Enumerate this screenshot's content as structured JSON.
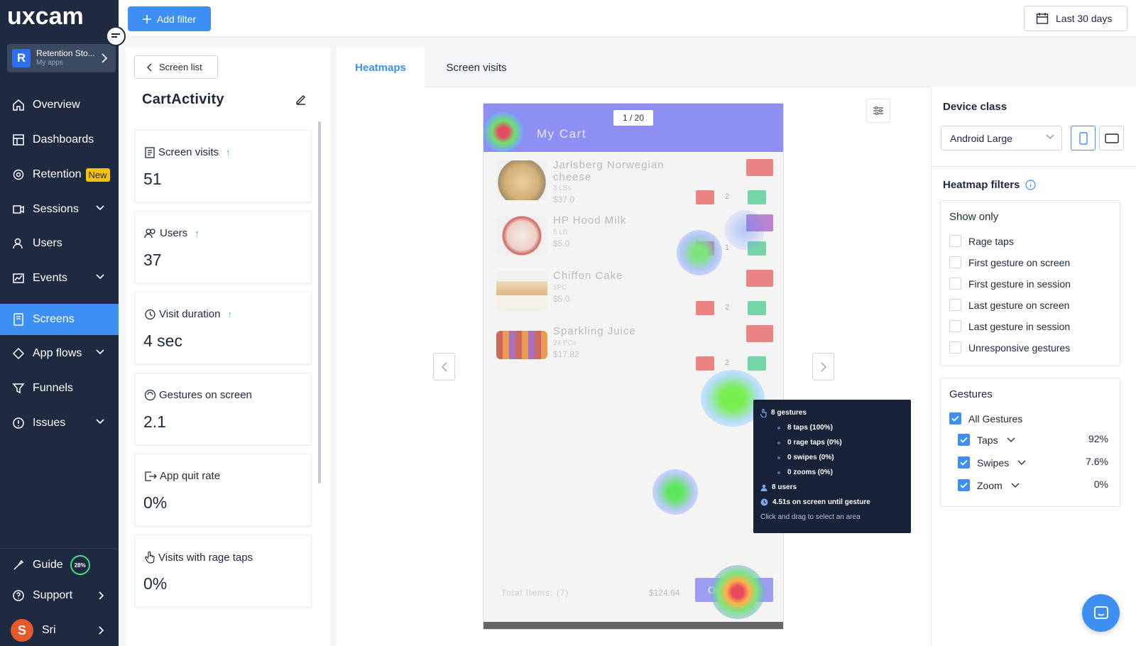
{
  "brand": {
    "logo_text": "uxcam"
  },
  "app_switcher": {
    "avatar": "R",
    "name": "Retention Sto...",
    "subtitle": "My apps"
  },
  "nav": {
    "overview": "Overview",
    "dashboards": "Dashboards",
    "retention": "Retention",
    "retention_badge": "New",
    "sessions": "Sessions",
    "users": "Users",
    "events": "Events",
    "screens": "Screens",
    "app_flows": "App flows",
    "funnels": "Funnels",
    "issues": "Issues",
    "guide": "Guide",
    "guide_progress": "28%",
    "support": "Support",
    "user_initial": "S",
    "user_name": "Sri"
  },
  "topbar": {
    "add_filter": "Add filter",
    "date_range": "Last 30 days"
  },
  "left": {
    "screen_list": "Screen list",
    "screen_name": "CartActivity",
    "stats": [
      {
        "label": "Screen visits",
        "value": "51",
        "trend": "↑"
      },
      {
        "label": "Users",
        "value": "37",
        "trend": "↑"
      },
      {
        "label": "Visit duration",
        "value": "4 sec",
        "trend": "↑"
      },
      {
        "label": "Gestures on screen",
        "value": "2.1"
      },
      {
        "label": "App quit rate",
        "value": "0%"
      },
      {
        "label": "Visits with rage taps",
        "value": "0%"
      }
    ]
  },
  "tabs": {
    "heatmaps": "Heatmaps",
    "screen_visits": "Screen visits"
  },
  "phone": {
    "page": "1 / 20",
    "title": "My Cart",
    "items": [
      {
        "name": "Jarlsberg Norwegian cheese",
        "sub": "3 LBs",
        "price": "$37.0",
        "qty": "2"
      },
      {
        "name": "HP Hood Milk",
        "sub": "5 LB",
        "price": "$5.0",
        "qty": "1"
      },
      {
        "name": "Chiffon Cake",
        "sub": "1PC",
        "price": "$5.0",
        "qty": "2"
      },
      {
        "name": "Sparkling Juice",
        "sub": "24 PCs",
        "price": "$17.82",
        "qty": "2"
      }
    ],
    "total_label": "Total Items: (7)",
    "total_price": "$124.64",
    "order": "Order"
  },
  "tooltip": {
    "gestures": "8 gestures",
    "taps": "8 taps (100%)",
    "rage": "0 rage taps (0%)",
    "swipes": "0 swipes (0%)",
    "zooms": "0 zooms (0%)",
    "users": "8 users",
    "time": "4.51s on screen until gesture",
    "hint": "Click and drag to select an area"
  },
  "right": {
    "device_class_title": "Device class",
    "device_value": "Android Large",
    "heatmap_filters_title": "Heatmap filters",
    "show_only_title": "Show only",
    "show_only": [
      "Rage taps",
      "First gesture on screen",
      "First gesture in session",
      "Last gesture on screen",
      "Last gesture in session",
      "Unresponsive gestures"
    ],
    "gestures_title": "Gestures",
    "all_gestures": "All Gestures",
    "gestures": [
      {
        "label": "Taps",
        "pct": "92%"
      },
      {
        "label": "Swipes",
        "pct": "7.6%"
      },
      {
        "label": "Zoom",
        "pct": "0%"
      }
    ]
  },
  "colors": {
    "sidebar": "#1e2a3f",
    "accent": "#3d8ff3",
    "badge": "#f5c400",
    "positive": "#2cc27a"
  },
  "icons": [
    "home-icon",
    "dashboard-icon",
    "retention-icon",
    "sessions-icon",
    "users-icon",
    "events-icon",
    "screens-icon",
    "app-flows-icon",
    "funnels-icon",
    "issues-icon",
    "guide-icon",
    "support-icon",
    "calendar-icon",
    "plus-icon",
    "edit-icon",
    "sliders-icon",
    "chat-icon",
    "info-icon"
  ]
}
